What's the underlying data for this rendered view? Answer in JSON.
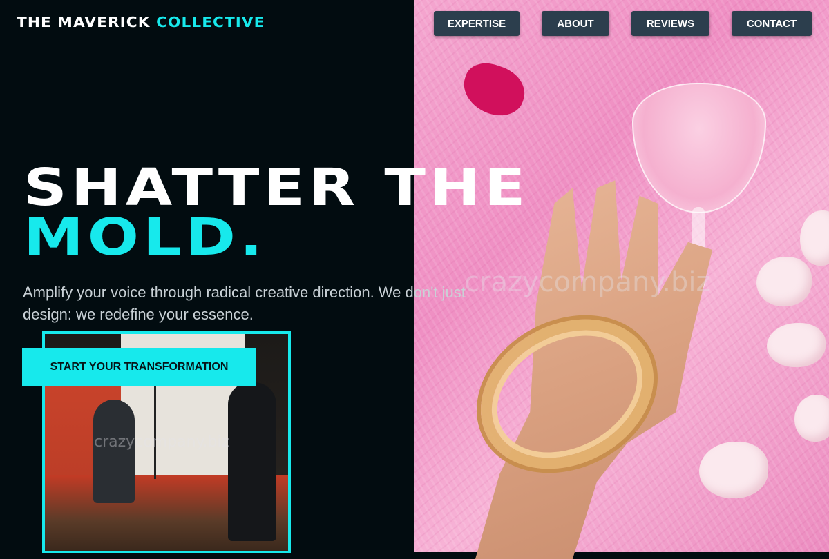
{
  "brand": {
    "name_part1": "THE MAVERICK",
    "name_part2": "COLLECTIVE",
    "accent_color": "#17e9ec"
  },
  "nav": {
    "items": [
      {
        "label": "EXPERTISE"
      },
      {
        "label": "ABOUT"
      },
      {
        "label": "REVIEWS"
      },
      {
        "label": "CONTACT"
      }
    ]
  },
  "hero": {
    "headline_line1": "SHATTER THE",
    "headline_line2": "MOLD.",
    "lead": "Amplify your voice through radical creative direction. We don't just design: we redefine your essence.",
    "cta_label": "START YOUR TRANSFORMATION",
    "photo_subject": "hand-with-gold-bracelets-and-pink-cocktail",
    "inset_photo_subject": "studio-photoshoot"
  },
  "watermarks": [
    "crazycompany.biz",
    "crazycompany.biz"
  ],
  "colors": {
    "background": "#020c10",
    "accent": "#17e9ec",
    "nav_button": "#2c3e4d"
  }
}
